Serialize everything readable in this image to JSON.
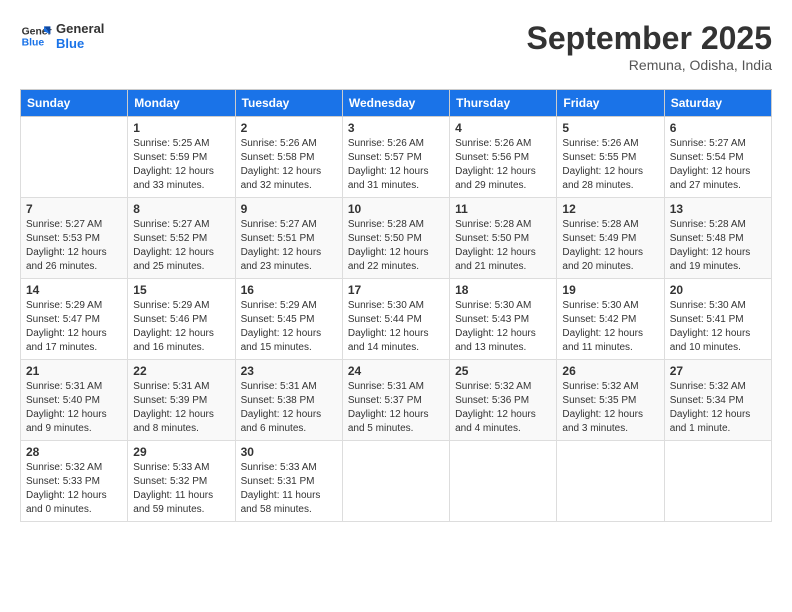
{
  "logo": {
    "line1": "General",
    "line2": "Blue"
  },
  "title": "September 2025",
  "location": "Remuna, Odisha, India",
  "days_of_week": [
    "Sunday",
    "Monday",
    "Tuesday",
    "Wednesday",
    "Thursday",
    "Friday",
    "Saturday"
  ],
  "weeks": [
    [
      {
        "day": "",
        "info": ""
      },
      {
        "day": "1",
        "info": "Sunrise: 5:25 AM\nSunset: 5:59 PM\nDaylight: 12 hours\nand 33 minutes."
      },
      {
        "day": "2",
        "info": "Sunrise: 5:26 AM\nSunset: 5:58 PM\nDaylight: 12 hours\nand 32 minutes."
      },
      {
        "day": "3",
        "info": "Sunrise: 5:26 AM\nSunset: 5:57 PM\nDaylight: 12 hours\nand 31 minutes."
      },
      {
        "day": "4",
        "info": "Sunrise: 5:26 AM\nSunset: 5:56 PM\nDaylight: 12 hours\nand 29 minutes."
      },
      {
        "day": "5",
        "info": "Sunrise: 5:26 AM\nSunset: 5:55 PM\nDaylight: 12 hours\nand 28 minutes."
      },
      {
        "day": "6",
        "info": "Sunrise: 5:27 AM\nSunset: 5:54 PM\nDaylight: 12 hours\nand 27 minutes."
      }
    ],
    [
      {
        "day": "7",
        "info": "Sunrise: 5:27 AM\nSunset: 5:53 PM\nDaylight: 12 hours\nand 26 minutes."
      },
      {
        "day": "8",
        "info": "Sunrise: 5:27 AM\nSunset: 5:52 PM\nDaylight: 12 hours\nand 25 minutes."
      },
      {
        "day": "9",
        "info": "Sunrise: 5:27 AM\nSunset: 5:51 PM\nDaylight: 12 hours\nand 23 minutes."
      },
      {
        "day": "10",
        "info": "Sunrise: 5:28 AM\nSunset: 5:50 PM\nDaylight: 12 hours\nand 22 minutes."
      },
      {
        "day": "11",
        "info": "Sunrise: 5:28 AM\nSunset: 5:50 PM\nDaylight: 12 hours\nand 21 minutes."
      },
      {
        "day": "12",
        "info": "Sunrise: 5:28 AM\nSunset: 5:49 PM\nDaylight: 12 hours\nand 20 minutes."
      },
      {
        "day": "13",
        "info": "Sunrise: 5:28 AM\nSunset: 5:48 PM\nDaylight: 12 hours\nand 19 minutes."
      }
    ],
    [
      {
        "day": "14",
        "info": "Sunrise: 5:29 AM\nSunset: 5:47 PM\nDaylight: 12 hours\nand 17 minutes."
      },
      {
        "day": "15",
        "info": "Sunrise: 5:29 AM\nSunset: 5:46 PM\nDaylight: 12 hours\nand 16 minutes."
      },
      {
        "day": "16",
        "info": "Sunrise: 5:29 AM\nSunset: 5:45 PM\nDaylight: 12 hours\nand 15 minutes."
      },
      {
        "day": "17",
        "info": "Sunrise: 5:30 AM\nSunset: 5:44 PM\nDaylight: 12 hours\nand 14 minutes."
      },
      {
        "day": "18",
        "info": "Sunrise: 5:30 AM\nSunset: 5:43 PM\nDaylight: 12 hours\nand 13 minutes."
      },
      {
        "day": "19",
        "info": "Sunrise: 5:30 AM\nSunset: 5:42 PM\nDaylight: 12 hours\nand 11 minutes."
      },
      {
        "day": "20",
        "info": "Sunrise: 5:30 AM\nSunset: 5:41 PM\nDaylight: 12 hours\nand 10 minutes."
      }
    ],
    [
      {
        "day": "21",
        "info": "Sunrise: 5:31 AM\nSunset: 5:40 PM\nDaylight: 12 hours\nand 9 minutes."
      },
      {
        "day": "22",
        "info": "Sunrise: 5:31 AM\nSunset: 5:39 PM\nDaylight: 12 hours\nand 8 minutes."
      },
      {
        "day": "23",
        "info": "Sunrise: 5:31 AM\nSunset: 5:38 PM\nDaylight: 12 hours\nand 6 minutes."
      },
      {
        "day": "24",
        "info": "Sunrise: 5:31 AM\nSunset: 5:37 PM\nDaylight: 12 hours\nand 5 minutes."
      },
      {
        "day": "25",
        "info": "Sunrise: 5:32 AM\nSunset: 5:36 PM\nDaylight: 12 hours\nand 4 minutes."
      },
      {
        "day": "26",
        "info": "Sunrise: 5:32 AM\nSunset: 5:35 PM\nDaylight: 12 hours\nand 3 minutes."
      },
      {
        "day": "27",
        "info": "Sunrise: 5:32 AM\nSunset: 5:34 PM\nDaylight: 12 hours\nand 1 minute."
      }
    ],
    [
      {
        "day": "28",
        "info": "Sunrise: 5:32 AM\nSunset: 5:33 PM\nDaylight: 12 hours\nand 0 minutes."
      },
      {
        "day": "29",
        "info": "Sunrise: 5:33 AM\nSunset: 5:32 PM\nDaylight: 11 hours\nand 59 minutes."
      },
      {
        "day": "30",
        "info": "Sunrise: 5:33 AM\nSunset: 5:31 PM\nDaylight: 11 hours\nand 58 minutes."
      },
      {
        "day": "",
        "info": ""
      },
      {
        "day": "",
        "info": ""
      },
      {
        "day": "",
        "info": ""
      },
      {
        "day": "",
        "info": ""
      }
    ]
  ]
}
